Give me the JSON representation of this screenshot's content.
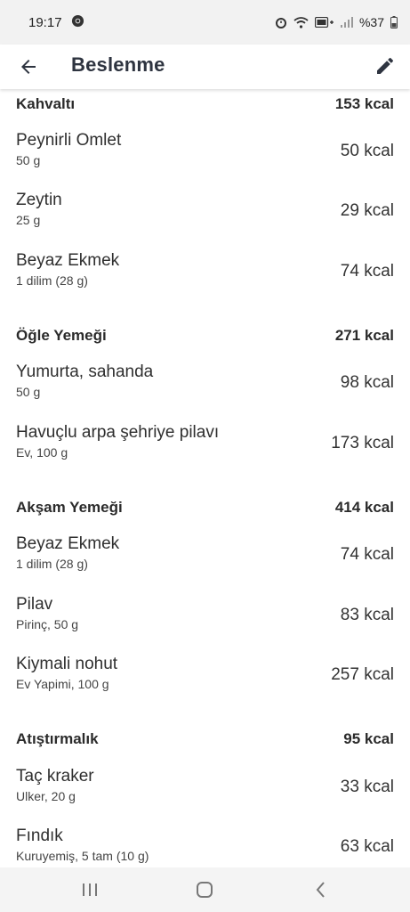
{
  "status": {
    "time": "19:17",
    "battery": "%37"
  },
  "header": {
    "title": "Beslenme"
  },
  "meals": [
    {
      "name": "Kahvaltı",
      "total": "153 kcal",
      "items": [
        {
          "name": "Peynirli Omlet",
          "detail": "50 g",
          "kcal": "50 kcal"
        },
        {
          "name": "Zeytin",
          "detail": "25 g",
          "kcal": "29 kcal"
        },
        {
          "name": "Beyaz Ekmek",
          "detail": "1 dilim (28 g)",
          "kcal": "74 kcal"
        }
      ]
    },
    {
      "name": "Öğle Yemeği",
      "total": "271 kcal",
      "items": [
        {
          "name": "Yumurta, sahanda",
          "detail": "50 g",
          "kcal": "98 kcal"
        },
        {
          "name": "Havuçlu arpa şehriye pilavı",
          "detail": "Ev, 100 g",
          "kcal": "173 kcal"
        }
      ]
    },
    {
      "name": "Akşam Yemeği",
      "total": "414 kcal",
      "items": [
        {
          "name": "Beyaz Ekmek",
          "detail": "1 dilim (28 g)",
          "kcal": "74 kcal"
        },
        {
          "name": "Pilav",
          "detail": "Pirinç, 50 g",
          "kcal": "83 kcal"
        },
        {
          "name": "Kiymali nohut",
          "detail": "Ev Yapimi, 100 g",
          "kcal": "257 kcal"
        }
      ]
    },
    {
      "name": "Atıştırmalık",
      "total": "95 kcal",
      "items": [
        {
          "name": "Taç kraker",
          "detail": "Ulker, 20 g",
          "kcal": "33 kcal"
        },
        {
          "name": "Fındık",
          "detail": "Kuruyemiş, 5 tam (10 g)",
          "kcal": "63 kcal"
        }
      ]
    }
  ],
  "icons": {
    "back": "arrow-left-icon",
    "edit": "pencil-icon",
    "recents": "recents-icon",
    "home": "home-icon",
    "nav_back": "chevron-left-icon"
  }
}
